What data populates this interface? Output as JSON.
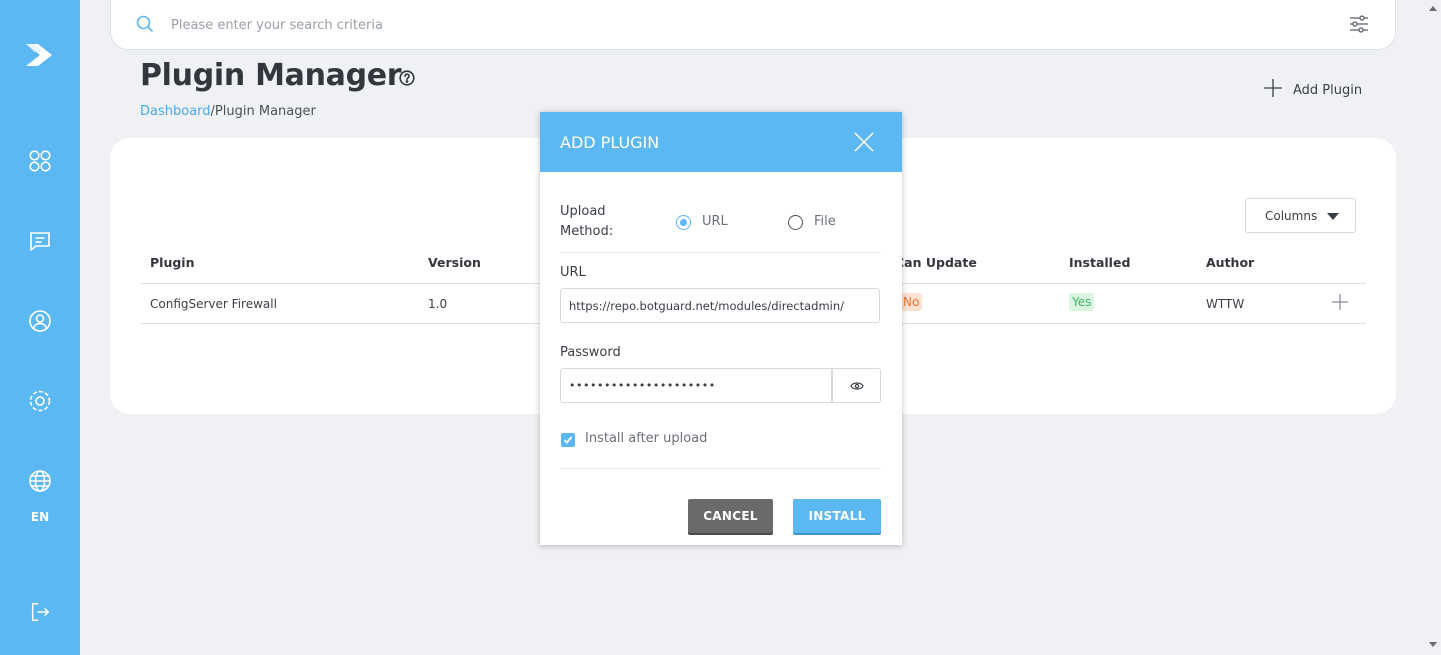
{
  "search": {
    "placeholder": "Please enter your search criteria"
  },
  "header": {
    "title": "Plugin Manager",
    "breadcrumb": {
      "link": "Dashboard",
      "separator": "/",
      "current": "Plugin Manager"
    },
    "add_plugin_label": "Add Plugin"
  },
  "sidebar": {
    "language": "EN"
  },
  "table": {
    "columns_button": "Columns",
    "headers": {
      "plugin": "Plugin",
      "version": "Version",
      "can_update": "Can Update",
      "installed": "Installed",
      "author": "Author"
    },
    "rows": [
      {
        "plugin": "ConfigServer Firewall",
        "version": "1.0",
        "can_update": "No",
        "installed": "Yes",
        "author": "WTTW"
      }
    ]
  },
  "modal": {
    "title": "ADD PLUGIN",
    "upload_method_line1": "Upload",
    "upload_method_line2": "Method:",
    "option_url": "URL",
    "option_file": "File",
    "selected_option": "URL",
    "url_label": "URL",
    "url_value": "https://repo.botguard.net/modules/directadmin/",
    "password_label": "Password",
    "password_value": "•••••••••••••••••••••",
    "install_after_upload_label": "Install after upload",
    "install_after_upload_checked": true,
    "cancel_label": "CANCEL",
    "install_label": "INSTALL"
  },
  "colors": {
    "accent": "#5cb8f2",
    "badge_no_bg": "#fde2d2",
    "badge_yes_bg": "#dcf5e2"
  }
}
